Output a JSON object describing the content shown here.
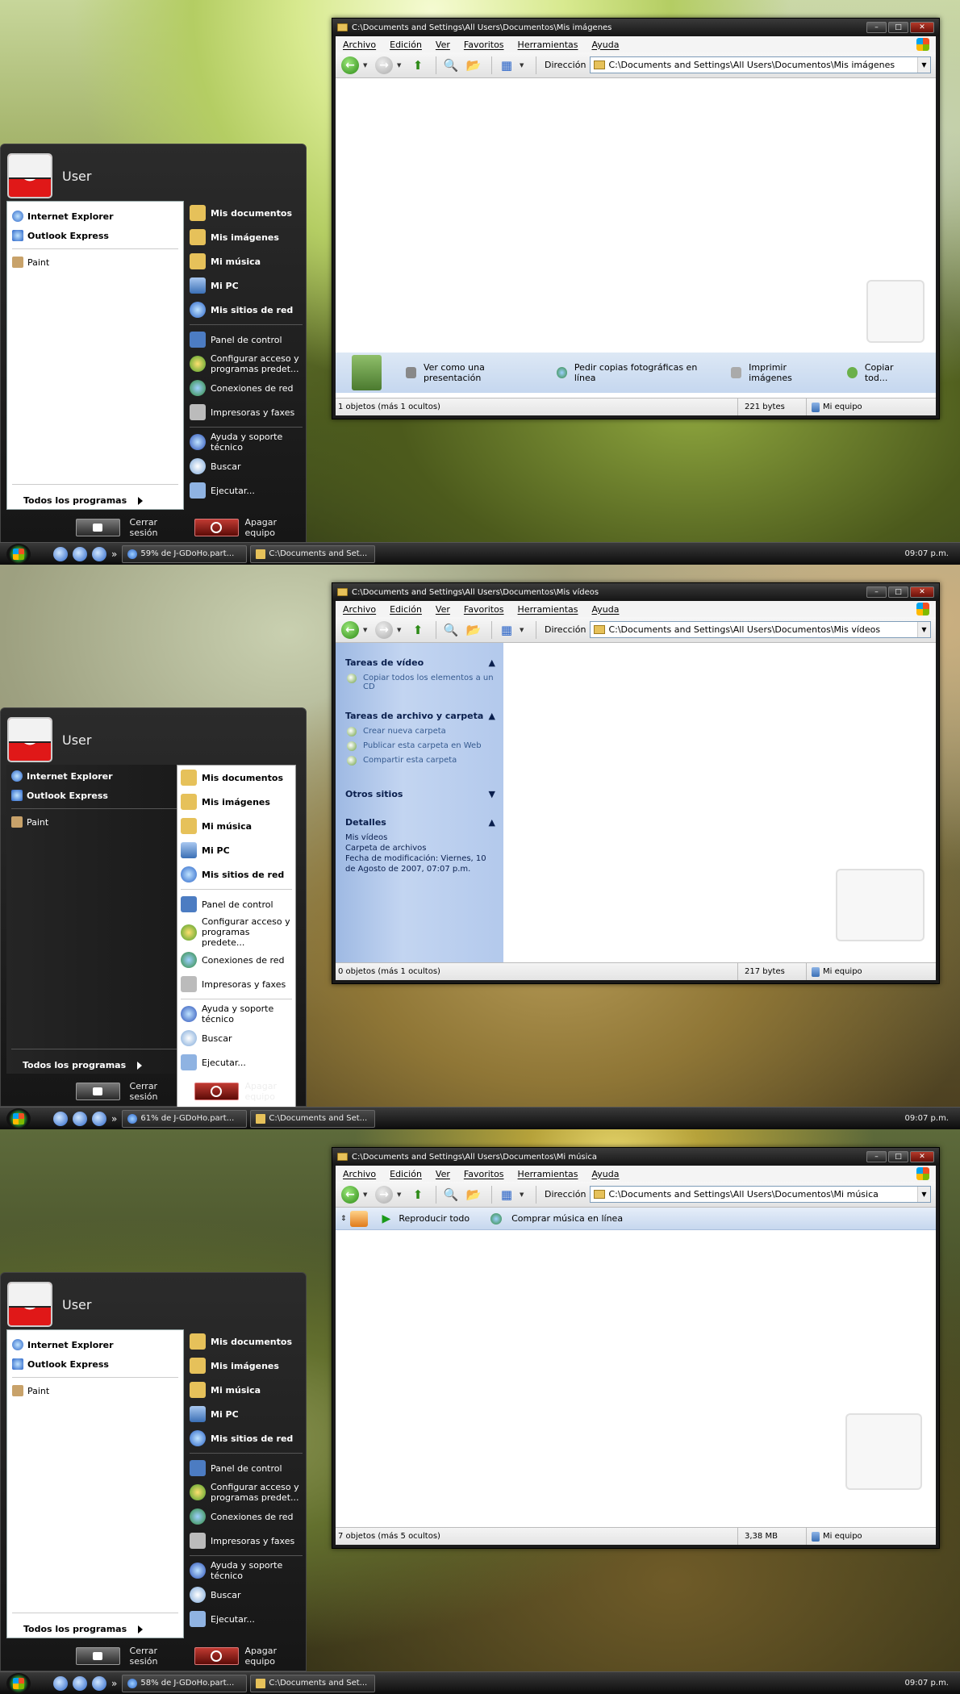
{
  "menu": [
    "Archivo",
    "Edición",
    "Ver",
    "Favoritos",
    "Herramientas",
    "Ayuda"
  ],
  "address_label": "Dirección",
  "clock": "09:07 p.m.",
  "start": {
    "user": "User",
    "pinned": [
      "Internet Explorer",
      "Outlook Express"
    ],
    "recent": [
      "Paint"
    ],
    "all_programs": "Todos los programas",
    "right": [
      "Mis documentos",
      "Mis imágenes",
      "Mi música",
      "Mi PC",
      "Mis sitios de red"
    ],
    "right2": [
      "Panel de control",
      "Configurar acceso y programas predet...",
      "Conexiones de red",
      "Impresoras y faxes"
    ],
    "right3": [
      "Ayuda y soporte técnico",
      "Buscar",
      "Ejecutar..."
    ],
    "logoff": "Cerrar sesión",
    "shutdown": "Apagar equipo"
  },
  "start_mid": {
    "right2": [
      "Panel de control",
      "Configurar acceso y programas predete...",
      "Conexiones de red",
      "Impresoras y faxes"
    ]
  },
  "panels": [
    {
      "title": "C:\\Documents and Settings\\All Users\\Documentos\\Mis imágenes",
      "address": "C:\\Documents and Settings\\All Users\\Documentos\\Mis imágenes",
      "tasks": [
        "Ver como una presentación",
        "Pedir copias fotográficas en línea",
        "Imprimir imágenes",
        "Copiar tod..."
      ],
      "status": [
        "1 objetos (más 1 ocultos)",
        "221 bytes",
        "Mi equipo"
      ],
      "taskbar": [
        "59% de J-GDoHo.part...",
        "C:\\Documents and Set..."
      ]
    },
    {
      "title": "C:\\Documents and Settings\\All Users\\Documentos\\Mis vídeos",
      "address": "C:\\Documents and Settings\\All Users\\Documentos\\Mis vídeos",
      "sidebar": {
        "video_head": "Tareas de vídeo",
        "video_item": "Copiar todos los elementos a un CD",
        "file_head": "Tareas de archivo y carpeta",
        "file_items": [
          "Crear nueva carpeta",
          "Publicar esta carpeta en Web",
          "Compartir esta carpeta"
        ],
        "other_head": "Otros sitios",
        "details_head": "Detalles",
        "details": [
          "Mis vídeos",
          "Carpeta de archivos",
          "Fecha de modificación: Viernes, 10 de Agosto de 2007, 07:07 p.m."
        ]
      },
      "status": [
        "0 objetos (más 1 ocultos)",
        "217 bytes",
        "Mi equipo"
      ],
      "taskbar": [
        "61% de J-GDoHo.part...",
        "C:\\Documents and Set..."
      ]
    },
    {
      "title": "C:\\Documents and Settings\\All Users\\Documentos\\Mi música",
      "address": "C:\\Documents and Settings\\All Users\\Documentos\\Mi música",
      "tasks": [
        "Reproducir todo",
        "Comprar música en línea"
      ],
      "status": [
        "7 objetos (más 5 ocultos)",
        "3,38 MB",
        "Mi equipo"
      ],
      "taskbar": [
        "58% de J-GDoHo.part...",
        "C:\\Documents and Set..."
      ]
    }
  ]
}
